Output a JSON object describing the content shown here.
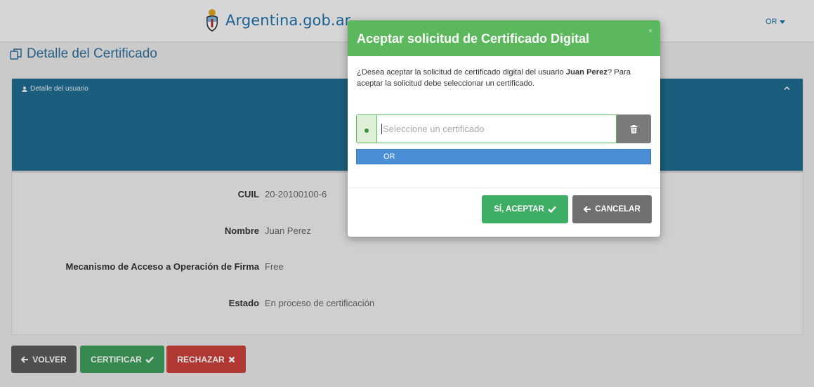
{
  "header": {
    "brand": "Argentina.gob.ar",
    "user_menu": "OR"
  },
  "page": {
    "title": "Detalle del Certificado"
  },
  "panel": {
    "header_label": "Detalle del usuario",
    "rows": [
      {
        "label": "CUIL",
        "value": "20-20100100-6"
      },
      {
        "label": "Nombre",
        "value": "Juan Perez"
      },
      {
        "label": "Mecanismo de Acceso a Operación de Firma",
        "value": "Free"
      },
      {
        "label": "Estado",
        "value": "En proceso de certificación"
      }
    ]
  },
  "actions": {
    "volver": "VOLVER",
    "certificar": "CERTIFICAR",
    "rechazar": "RECHAZAR"
  },
  "modal": {
    "title": "Aceptar solicitud de Certificado Digital",
    "close": "×",
    "text_before": "¿Desea aceptar la solicitud de certificado digital del usuario ",
    "user_name": "Juan Perez",
    "text_after": "? Para aceptar la solicitud debe seleccionar un certificado.",
    "select_placeholder": "Seleccione un certificado",
    "dropdown_option": "OR",
    "accept_label": "SÍ, ACEPTAR",
    "cancel_label": "CANCELAR"
  },
  "colors": {
    "modal_header": "#5cb85c",
    "panel_header": "#1e6a8e",
    "accept_button": "#3eae64",
    "cancel_button": "#707070",
    "certificar_button": "#3e9c5b",
    "rechazar_button": "#c9423b",
    "volver_button": "#5a5a5a",
    "dropdown_highlight": "#4a8fd6"
  },
  "icons": {
    "logo": "argentina-shield-icon",
    "title": "certificate-copy-icon",
    "user": "user-icon",
    "collapse": "chevron-up-icon",
    "back": "arrow-left-icon",
    "check": "check-icon",
    "reject": "times-icon",
    "trash": "trash-icon"
  }
}
